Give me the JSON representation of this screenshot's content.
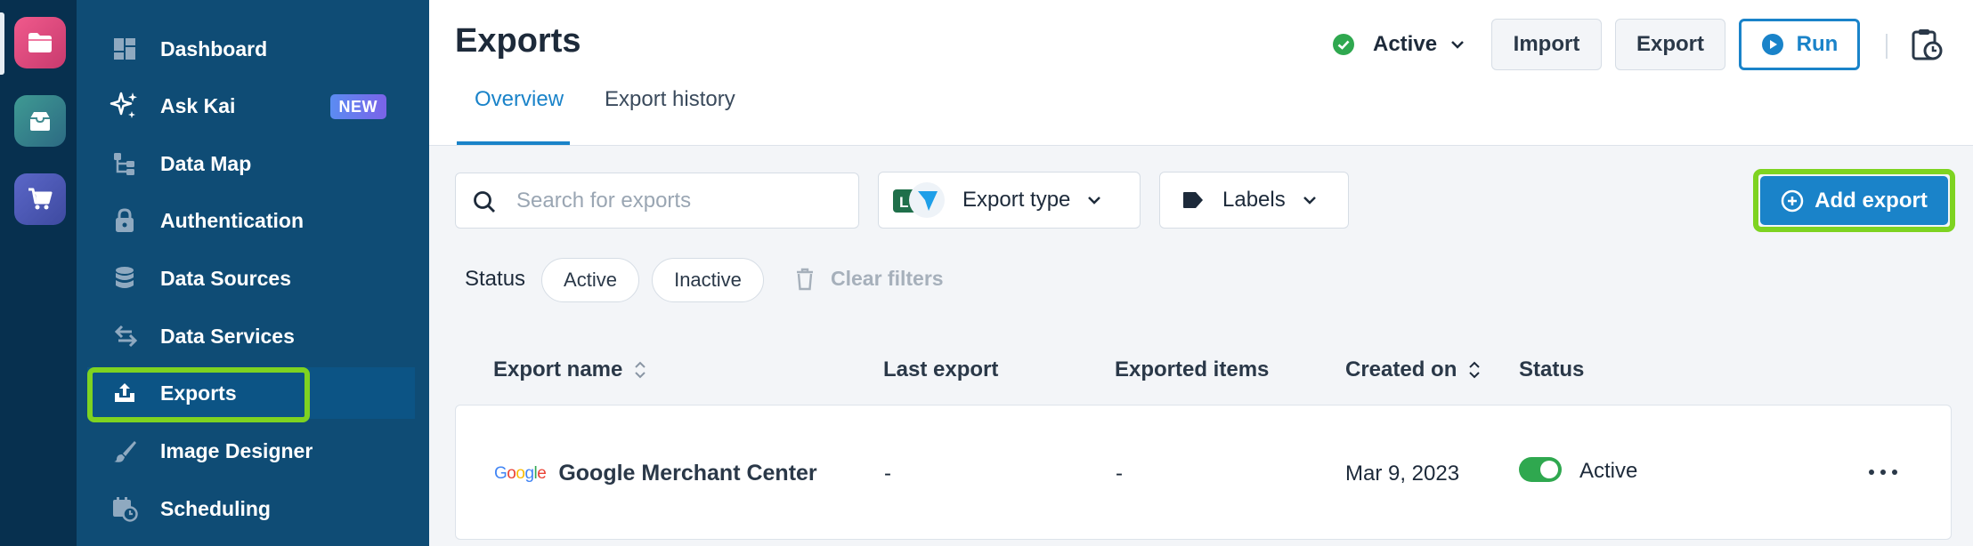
{
  "sidebar": {
    "items": [
      {
        "label": "Dashboard",
        "icon": "dashboard-icon"
      },
      {
        "label": "Ask Kai",
        "icon": "sparkle-icon",
        "badge": "NEW"
      },
      {
        "label": "Data Map",
        "icon": "data-map-icon"
      },
      {
        "label": "Authentication",
        "icon": "lock-icon"
      },
      {
        "label": "Data Sources",
        "icon": "database-icon"
      },
      {
        "label": "Data Services",
        "icon": "swap-arrows-icon"
      },
      {
        "label": "Exports",
        "icon": "upload-tray-icon",
        "selected": true
      },
      {
        "label": "Image Designer",
        "icon": "brush-icon"
      },
      {
        "label": "Scheduling",
        "icon": "calendar-clock-icon"
      }
    ]
  },
  "header": {
    "title": "Exports",
    "tabs": [
      {
        "label": "Overview",
        "active": true
      },
      {
        "label": "Export history",
        "active": false
      }
    ],
    "status": "Active",
    "import_label": "Import",
    "export_label": "Export",
    "run_label": "Run"
  },
  "filters": {
    "search_placeholder": "Search for exports",
    "export_type_label": "Export type",
    "labels_label": "Labels",
    "add_export_label": "Add export",
    "status_label": "Status",
    "status_chips": [
      "Active",
      "Inactive"
    ],
    "clear_filters_label": "Clear filters"
  },
  "table": {
    "columns": [
      "Export name",
      "Last export",
      "Exported items",
      "Created on",
      "Status"
    ],
    "rows": [
      {
        "logo_text": "Google",
        "name": "Google Merchant Center",
        "last_export": "-",
        "exported_items": "-",
        "created_on": "Mar 9, 2023",
        "status": "Active",
        "enabled": true
      }
    ]
  },
  "colors": {
    "sidebar_bg": "#0f4c75",
    "rail_bg": "#07304f",
    "accent": "#1a83c9",
    "highlight": "#7ed321",
    "success": "#2fa84f"
  }
}
